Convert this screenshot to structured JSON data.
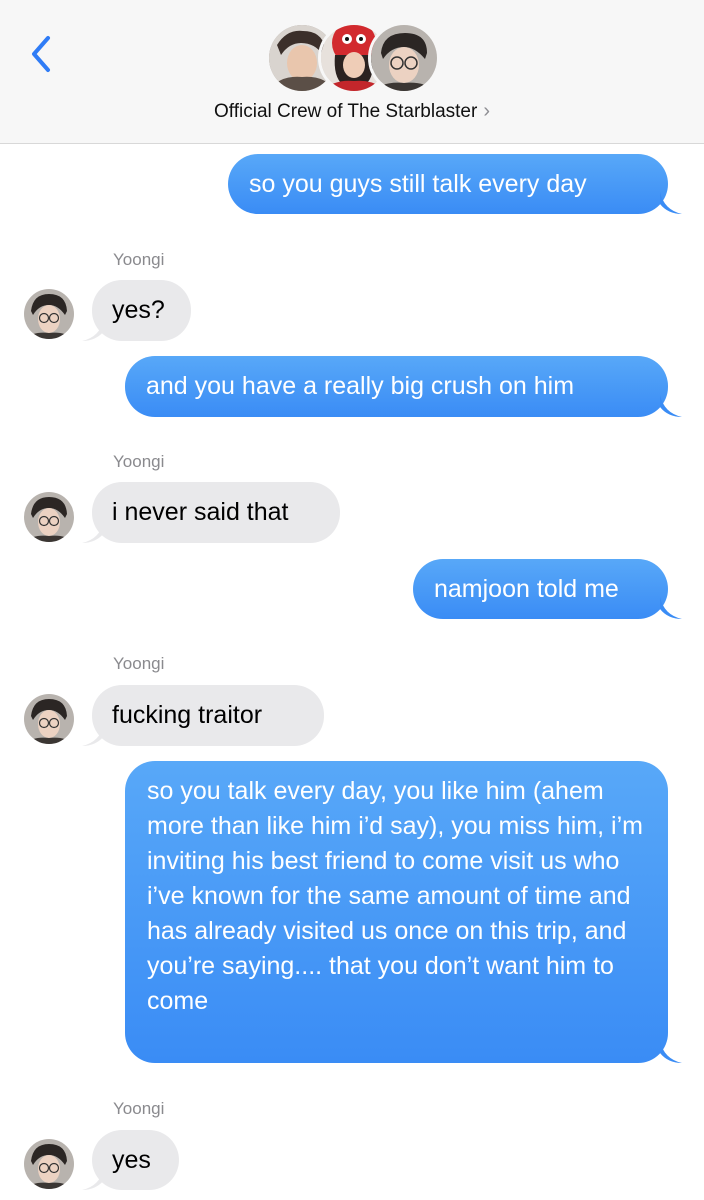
{
  "header": {
    "title": "Official Crew of The Starblaster",
    "chevron": "›",
    "accent": "#2f7cf6",
    "avatar_icons": [
      "group-member-1-avatar",
      "group-member-2-avatar",
      "group-member-3-avatar"
    ]
  },
  "colors": {
    "sent_bubble": "#4a9cf7",
    "received_bubble": "#e9e9eb",
    "sender_label": "#8a8a8e"
  },
  "messages": [
    {
      "direction": "sent",
      "text": "so you guys still talk every day"
    },
    {
      "direction": "received",
      "sender": "Yoongi",
      "text": "yes?"
    },
    {
      "direction": "sent",
      "text": "and you have a really big crush on him"
    },
    {
      "direction": "received",
      "sender": "Yoongi",
      "text": "i never said that"
    },
    {
      "direction": "sent",
      "text": "namjoon told me"
    },
    {
      "direction": "received",
      "sender": "Yoongi",
      "text": "fucking traitor"
    },
    {
      "direction": "sent",
      "text": "so you talk every day, you like him (ahem more than like him i’d say), you miss him, i’m inviting his best friend to come visit us who i’ve known for the same amount of time and has already visited us once on this trip, and you’re saying.... that you don’t want him to come"
    },
    {
      "direction": "received",
      "sender": "Yoongi",
      "text": "yes"
    }
  ]
}
